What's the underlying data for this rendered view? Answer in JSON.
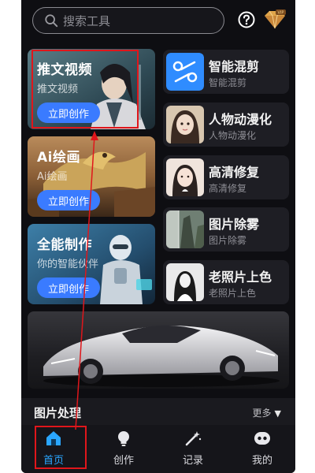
{
  "search": {
    "placeholder": "搜索工具"
  },
  "features": [
    {
      "title": "推文视频",
      "subtitle": "推文视频",
      "button": "立即创作"
    },
    {
      "title": "Ai绘画",
      "subtitle": "Ai绘画",
      "button": "立即创作"
    },
    {
      "title": "全能制作",
      "subtitle": "你的智能伙伴",
      "button": "立即创作"
    }
  ],
  "tools": [
    {
      "name": "智能混剪",
      "desc": "智能混剪"
    },
    {
      "name": "人物动漫化",
      "desc": "人物动漫化"
    },
    {
      "name": "高清修复",
      "desc": "高清修复"
    },
    {
      "name": "图片除雾",
      "desc": "图片除雾"
    },
    {
      "name": "老照片上色",
      "desc": "老照片上色"
    }
  ],
  "section": {
    "title": "图片处理",
    "more": "更多"
  },
  "nav": [
    {
      "label": "首页",
      "active": true
    },
    {
      "label": "创作",
      "active": false
    },
    {
      "label": "记录",
      "active": false
    },
    {
      "label": "我的",
      "active": false
    }
  ],
  "colors": {
    "accent": "#3a7bff",
    "nav_active": "#2aa6ff",
    "annotation": "#e0161b",
    "background": "#0e0e12"
  }
}
